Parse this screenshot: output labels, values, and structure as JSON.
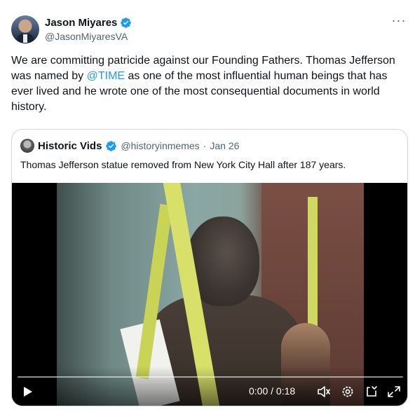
{
  "author": {
    "name": "Jason Miyares",
    "handle": "@JasonMiyaresVA"
  },
  "more_label": "···",
  "body": {
    "text_before": "We are committing patricide against our Founding Fathers.  Thomas Jefferson was named by ",
    "mention": "@TIME",
    "text_after": " as one of the most influential human beings that has ever lived and he wrote one of the most consequential documents in world history."
  },
  "quote": {
    "name": "Historic Vids",
    "handle": "@historyinmemes",
    "separator": "·",
    "date": "Jan 26",
    "text": "Thomas Jefferson statue removed from New York City Hall after 187 years."
  },
  "video": {
    "time": "0:00 / 0:18",
    "progress": 0.0
  },
  "colors": {
    "verified": "#1d9bf0",
    "link": "#1d9bf0"
  },
  "icons": {
    "verified": "verified-badge-icon",
    "play": "play-icon",
    "volume": "volume-icon",
    "settings": "settings-gear-icon",
    "captions": "captions-icon",
    "fullscreen": "fullscreen-icon"
  }
}
